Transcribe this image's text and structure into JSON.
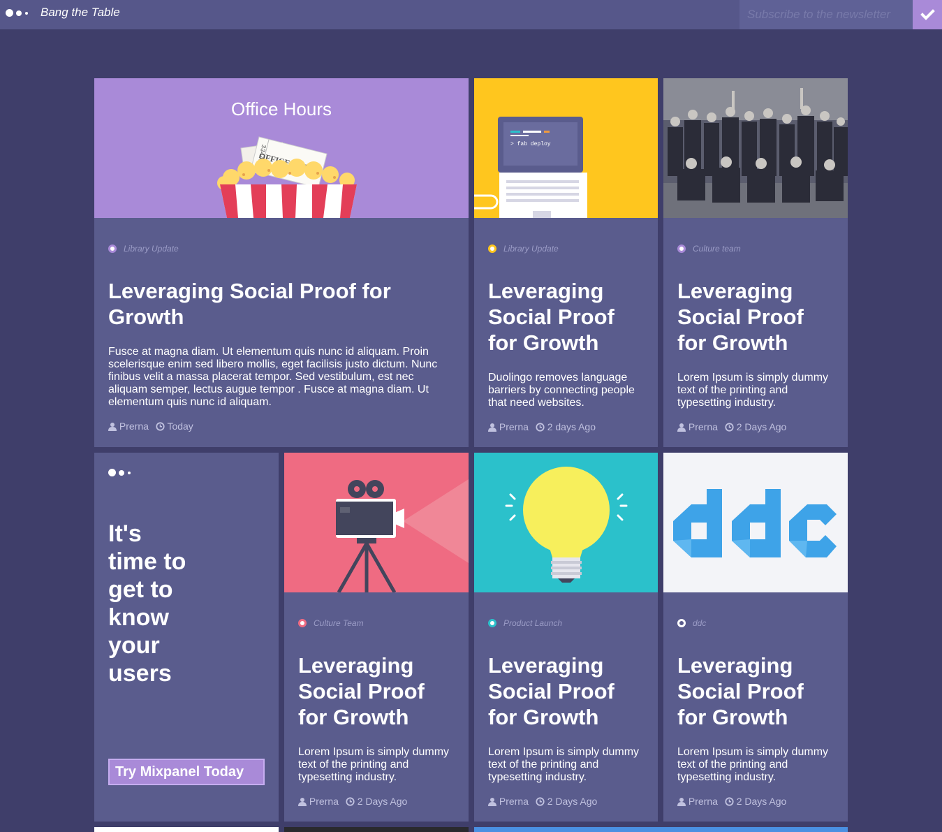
{
  "header": {
    "brand": "Bang the Table",
    "subscribe_placeholder": "Subscribe to the newsletter",
    "submit_icon": "check-icon"
  },
  "colors": {
    "page_bg": "#3f3e6a",
    "card_bg": "#5a5c8d",
    "accent_purple": "#a98ad8",
    "accent_yellow": "#ffc61e",
    "accent_pink": "#ef6b82",
    "accent_teal": "#2bc1cb",
    "accent_blue": "#3ea3e8"
  },
  "cards": [
    {
      "image": "office-hours-popcorn",
      "image_caption": "Office Hours",
      "ticket_text": "OFFICE HOURS",
      "ticket_number": "334432",
      "category": "Library Update",
      "category_color": "#a98ad8",
      "title": "Leveraging Social Proof for Growth",
      "description": "Fusce at magna diam. Ut elementum quis nunc id aliquam. Proin scelerisque enim sed libero mollis, eget facilisis justo dictum. Nunc finibus velit a massa placerat tempor. Sed vestibulum, est nec aliquam semper, lectus augue tempor . Fusce at magna diam. Ut elementum quis nunc id aliquam.",
      "author": "Prerna",
      "time": "Today"
    },
    {
      "image": "deploy-laptop",
      "terminal_text": "> fab deploy",
      "category": "Library Update",
      "category_color": "#ffc61e",
      "title": "Leveraging Social Proof for Growth",
      "description": "Duolingo removes language barriers by connecting people that need websites.",
      "author": "Prerna",
      "time": "2 days Ago"
    },
    {
      "image": "team-photo",
      "category": "Culture team",
      "category_color": "#a98ad8",
      "title": "Leveraging Social Proof for Growth",
      "description": "Lorem Ipsum is simply dummy text of the printing and typesetting industry.",
      "author": "Prerna",
      "time": "2 Days Ago"
    },
    {
      "image": "film-camera",
      "category": "Culture Team",
      "category_color": "#ef6b82",
      "title": "Leveraging Social Proof for Growth",
      "description": "Lorem Ipsum is simply dummy text of the printing and typesetting industry.",
      "author": "Prerna",
      "time": "2 Days Ago"
    },
    {
      "image": "light-bulb",
      "category": "Product Launch",
      "category_color": "#2bc1cb",
      "title": "Leveraging Social Proof for Growth",
      "description": "Lorem Ipsum is simply dummy text of the printing and typesetting industry.",
      "author": "Prerna",
      "time": "2 Days Ago"
    },
    {
      "image": "ddc-logo",
      "category": "ddc",
      "category_color": "#ffffff",
      "title": "Leveraging Social Proof for Growth",
      "description": "Lorem Ipsum is simply dummy text of the printing and typesetting industry.",
      "author": "Prerna",
      "time": "2 Days Ago"
    }
  ],
  "promo": {
    "title": "It's time to get to know your users",
    "button_label": "Try Mixpanel Today"
  }
}
